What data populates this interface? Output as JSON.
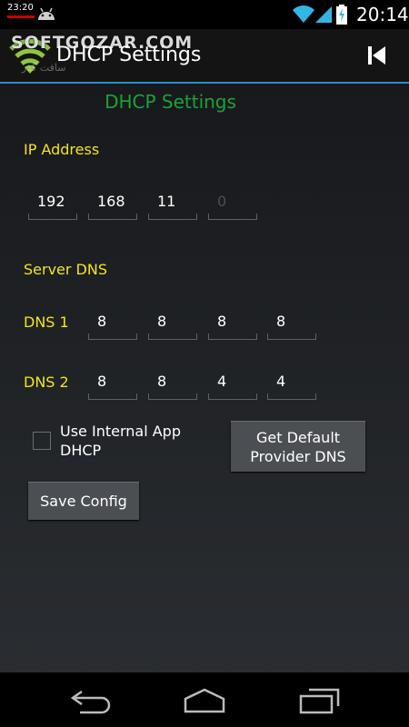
{
  "status_bar": {
    "small_time": "23:20",
    "time": "20:14"
  },
  "action_bar": {
    "title": "DHCP Settings",
    "watermark": "SOFTGOZAR.COM",
    "watermark_fa": "سافت گذر"
  },
  "screen_title": "DHCP Settings",
  "ip_address": {
    "label": "IP Address",
    "octets": [
      "192",
      "168",
      "11"
    ],
    "last_octet_hint": "0"
  },
  "server_dns": {
    "label": "Server DNS"
  },
  "dns1": {
    "label": "DNS 1",
    "octets": [
      "8",
      "8",
      "8",
      "8"
    ]
  },
  "dns2": {
    "label": "DNS 2",
    "octets": [
      "8",
      "8",
      "4",
      "4"
    ]
  },
  "internal_dhcp": {
    "label": "Use Internal App DHCP",
    "checked": false
  },
  "buttons": {
    "provider_dns": "Get Default Provider DNS",
    "save": "Save Config"
  },
  "colors": {
    "accent_blue": "#2b8ec9",
    "title_green": "#18a33a",
    "label_yellow": "#f2e51a"
  }
}
